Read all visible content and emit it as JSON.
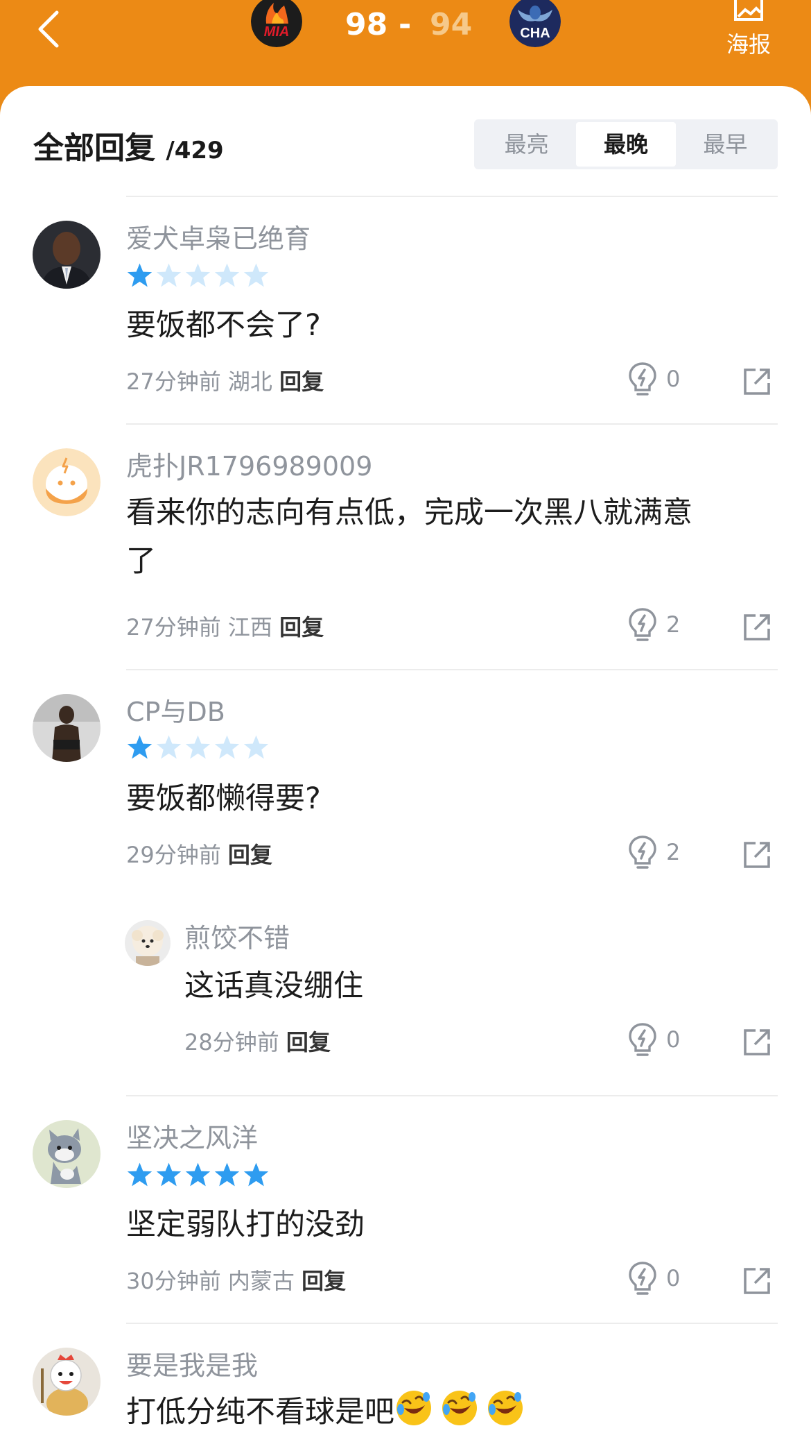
{
  "header": {
    "home_team": "MIA",
    "away_team": "CHA",
    "home_score": "98",
    "separator": "-",
    "away_score": "94",
    "poster_label": "海报",
    "accent_color": "#ec8a15"
  },
  "comments_header": {
    "title": "全部回复",
    "count": "/429",
    "sort_tabs": [
      "最亮",
      "最晚",
      "最早"
    ],
    "active_tab": "最晚"
  },
  "comments": [
    {
      "username": "爱犬卓枭已绝育",
      "rating": 1,
      "text": "要饭都不会了?",
      "time": "27分钟前",
      "location": "湖北",
      "reply_label": "回复",
      "likes": "0"
    },
    {
      "username": "虎扑JR1796989009",
      "text_line1": "看来你的志向有点低，完成一次黑八就满意",
      "text_line2": "了",
      "time": "27分钟前",
      "location": "江西",
      "reply_label": "回复",
      "likes": "2"
    },
    {
      "username": "CP与DB",
      "rating": 1,
      "text": "要饭都懒得要?",
      "time": "29分钟前",
      "reply_label": "回复",
      "likes": "2",
      "sub_reply": {
        "username": "煎饺不错",
        "text": "这话真没绷住",
        "time": "28分钟前",
        "reply_label": "回复",
        "likes": "0"
      }
    },
    {
      "username": "坚决之风洋",
      "rating": 5,
      "text": "坚定弱队打的没劲",
      "time": "30分钟前",
      "location": "内蒙古",
      "reply_label": "回复",
      "likes": "0"
    },
    {
      "username": "要是我是我",
      "text": "打低分纯不看球是吧",
      "emojis": [
        "rofl-emoji",
        "rofl-emoji",
        "rofl-emoji"
      ]
    }
  ],
  "icons": {
    "back": "chevron-left-icon",
    "poster": "image-icon",
    "like": "lightbulb-icon",
    "share": "share-external-icon",
    "star_filled_color": "#2e9cf0",
    "star_empty_color": "#cfe8fb"
  }
}
